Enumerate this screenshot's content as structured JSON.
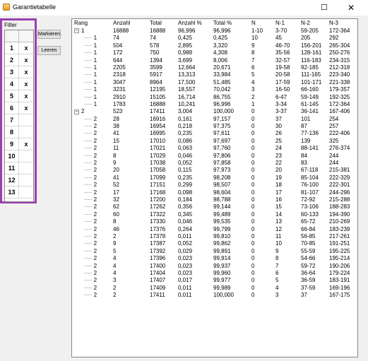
{
  "window": {
    "title": "Garantietabelle",
    "maximize_glyph": "☐",
    "close_glyph": "✕"
  },
  "filter": {
    "label": "Filter",
    "rows": [
      {
        "num": "1",
        "mark": "x"
      },
      {
        "num": "2",
        "mark": "x"
      },
      {
        "num": "3",
        "mark": "x"
      },
      {
        "num": "4",
        "mark": "x"
      },
      {
        "num": "5",
        "mark": "x"
      },
      {
        "num": "6",
        "mark": "x"
      },
      {
        "num": "7",
        "mark": ""
      },
      {
        "num": "8",
        "mark": ""
      },
      {
        "num": "9",
        "mark": "x"
      },
      {
        "num": "10",
        "mark": ""
      },
      {
        "num": "11",
        "mark": ""
      },
      {
        "num": "12",
        "mark": ""
      },
      {
        "num": "13",
        "mark": ""
      }
    ]
  },
  "buttons": {
    "markieren": "Markieren",
    "leeren": "Leeren"
  },
  "table": {
    "columns": [
      "Rang",
      "Anzahl",
      "Total",
      "Anzahl %",
      "Total %",
      "N",
      "N-1",
      "N-2",
      "N-3"
    ],
    "rows": [
      {
        "level": 0,
        "rang": "1",
        "toggle": "−",
        "anzahl": "16888",
        "total": "16888",
        "anzahl_pct": "96,996",
        "total_pct": "96,996",
        "n": "1-10",
        "n1": "3-70",
        "n2": "59-205",
        "n3": "172-364"
      },
      {
        "level": 1,
        "rang": "1",
        "anzahl": "74",
        "total": "74",
        "anzahl_pct": "0,425",
        "total_pct": "0,425",
        "n": "10",
        "n1": "45",
        "n2": "205",
        "n3": "292"
      },
      {
        "level": 1,
        "rang": "1",
        "anzahl": "504",
        "total": "578",
        "anzahl_pct": "2,895",
        "total_pct": "3,320",
        "n": "9",
        "n1": "46-70",
        "n2": "156-201",
        "n3": "265-304"
      },
      {
        "level": 1,
        "rang": "1",
        "anzahl": "172",
        "total": "750",
        "anzahl_pct": "0,988",
        "total_pct": "4,308",
        "n": "8",
        "n1": "35-56",
        "n2": "128-161",
        "n3": "250-276"
      },
      {
        "level": 1,
        "rang": "1",
        "anzahl": "644",
        "total": "1394",
        "anzahl_pct": "3,699",
        "total_pct": "8,006",
        "n": "7",
        "n1": "32-57",
        "n2": "116-183",
        "n3": "234-315"
      },
      {
        "level": 1,
        "rang": "1",
        "anzahl": "2205",
        "total": "3599",
        "anzahl_pct": "12,664",
        "total_pct": "20,671",
        "n": "6",
        "n1": "19-58",
        "n2": "92-185",
        "n3": "212-318"
      },
      {
        "level": 1,
        "rang": "1",
        "anzahl": "2318",
        "total": "5917",
        "anzahl_pct": "13,313",
        "total_pct": "33,984",
        "n": "5",
        "n1": "20-58",
        "n2": "111-165",
        "n3": "223-340"
      },
      {
        "level": 1,
        "rang": "1",
        "anzahl": "3047",
        "total": "8964",
        "anzahl_pct": "17,500",
        "total_pct": "51,485",
        "n": "4",
        "n1": "17-59",
        "n2": "101-171",
        "n3": "221-338"
      },
      {
        "level": 1,
        "rang": "1",
        "anzahl": "3231",
        "total": "12195",
        "anzahl_pct": "18,557",
        "total_pct": "70,042",
        "n": "3",
        "n1": "16-50",
        "n2": "66-160",
        "n3": "179-357"
      },
      {
        "level": 1,
        "rang": "1",
        "anzahl": "2910",
        "total": "15105",
        "anzahl_pct": "16,714",
        "total_pct": "86,755",
        "n": "2",
        "n1": "6-47",
        "n2": "59-149",
        "n3": "192-325"
      },
      {
        "level": 1,
        "rang": "1",
        "anzahl": "1783",
        "total": "16888",
        "anzahl_pct": "10,241",
        "total_pct": "96,996",
        "n": "1",
        "n1": "3-34",
        "n2": "61-145",
        "n3": "172-364"
      },
      {
        "level": 0,
        "rang": "2",
        "toggle": "−",
        "anzahl": "523",
        "total": "17411",
        "anzahl_pct": "3,004",
        "total_pct": "100,000",
        "n": "0",
        "n1": "3-37",
        "n2": "36-141",
        "n3": "167-406"
      },
      {
        "level": 1,
        "rang": "2",
        "anzahl": "28",
        "total": "16916",
        "anzahl_pct": "0,161",
        "total_pct": "97,157",
        "n": "0",
        "n1": "37",
        "n2": "101",
        "n3": "254"
      },
      {
        "level": 1,
        "rang": "2",
        "anzahl": "38",
        "total": "16954",
        "anzahl_pct": "0,218",
        "total_pct": "97,375",
        "n": "0",
        "n1": "30",
        "n2": "87",
        "n3": "257"
      },
      {
        "level": 1,
        "rang": "2",
        "anzahl": "41",
        "total": "16995",
        "anzahl_pct": "0,235",
        "total_pct": "97,611",
        "n": "0",
        "n1": "26",
        "n2": "77-136",
        "n3": "222-406"
      },
      {
        "level": 1,
        "rang": "2",
        "anzahl": "15",
        "total": "17010",
        "anzahl_pct": "0,086",
        "total_pct": "97,697",
        "n": "0",
        "n1": "25",
        "n2": "139",
        "n3": "325"
      },
      {
        "level": 1,
        "rang": "2",
        "anzahl": "11",
        "total": "17021",
        "anzahl_pct": "0,063",
        "total_pct": "97,760",
        "n": "0",
        "n1": "24",
        "n2": "88-141",
        "n3": "276-374"
      },
      {
        "level": 1,
        "rang": "2",
        "anzahl": "8",
        "total": "17029",
        "anzahl_pct": "0,046",
        "total_pct": "97,806",
        "n": "0",
        "n1": "23",
        "n2": "84",
        "n3": "244"
      },
      {
        "level": 1,
        "rang": "2",
        "anzahl": "9",
        "total": "17038",
        "anzahl_pct": "0,052",
        "total_pct": "97,858",
        "n": "0",
        "n1": "22",
        "n2": "83",
        "n3": "244"
      },
      {
        "level": 1,
        "rang": "2",
        "anzahl": "20",
        "total": "17058",
        "anzahl_pct": "0,115",
        "total_pct": "97,973",
        "n": "0",
        "n1": "20",
        "n2": "67-118",
        "n3": "215-381"
      },
      {
        "level": 1,
        "rang": "2",
        "anzahl": "41",
        "total": "17099",
        "anzahl_pct": "0,235",
        "total_pct": "98,208",
        "n": "0",
        "n1": "19",
        "n2": "85-104",
        "n3": "222-329"
      },
      {
        "level": 1,
        "rang": "2",
        "anzahl": "52",
        "total": "17151",
        "anzahl_pct": "0,299",
        "total_pct": "98,507",
        "n": "0",
        "n1": "18",
        "n2": "76-100",
        "n3": "222-301"
      },
      {
        "level": 1,
        "rang": "2",
        "anzahl": "17",
        "total": "17168",
        "anzahl_pct": "0,098",
        "total_pct": "98,604",
        "n": "0",
        "n1": "17",
        "n2": "81-107",
        "n3": "244-296"
      },
      {
        "level": 1,
        "rang": "2",
        "anzahl": "32",
        "total": "17200",
        "anzahl_pct": "0,184",
        "total_pct": "98,788",
        "n": "0",
        "n1": "16",
        "n2": "72-92",
        "n3": "215-288"
      },
      {
        "level": 1,
        "rang": "2",
        "anzahl": "62",
        "total": "17262",
        "anzahl_pct": "0,356",
        "total_pct": "99,144",
        "n": "0",
        "n1": "15",
        "n2": "73-106",
        "n3": "188-283"
      },
      {
        "level": 1,
        "rang": "2",
        "anzahl": "60",
        "total": "17322",
        "anzahl_pct": "0,345",
        "total_pct": "99,489",
        "n": "0",
        "n1": "14",
        "n2": "60-133",
        "n3": "194-390"
      },
      {
        "level": 1,
        "rang": "2",
        "anzahl": "8",
        "total": "17330",
        "anzahl_pct": "0,046",
        "total_pct": "99,535",
        "n": "0",
        "n1": "13",
        "n2": "65-72",
        "n3": "210-269"
      },
      {
        "level": 1,
        "rang": "2",
        "anzahl": "46",
        "total": "17376",
        "anzahl_pct": "0,264",
        "total_pct": "99,799",
        "n": "0",
        "n1": "12",
        "n2": "66-84",
        "n3": "183-239"
      },
      {
        "level": 1,
        "rang": "2",
        "anzahl": "2",
        "total": "17378",
        "anzahl_pct": "0,011",
        "total_pct": "99,810",
        "n": "0",
        "n1": "11",
        "n2": "56-85",
        "n3": "217-261"
      },
      {
        "level": 1,
        "rang": "2",
        "anzahl": "9",
        "total": "17387",
        "anzahl_pct": "0,052",
        "total_pct": "99,862",
        "n": "0",
        "n1": "10",
        "n2": "70-85",
        "n3": "191-251"
      },
      {
        "level": 1,
        "rang": "2",
        "anzahl": "5",
        "total": "17392",
        "anzahl_pct": "0,029",
        "total_pct": "99,891",
        "n": "0",
        "n1": "9",
        "n2": "55-59",
        "n3": "195-225"
      },
      {
        "level": 1,
        "rang": "2",
        "anzahl": "4",
        "total": "17396",
        "anzahl_pct": "0,023",
        "total_pct": "99,914",
        "n": "0",
        "n1": "8",
        "n2": "54-66",
        "n3": "195-214"
      },
      {
        "level": 1,
        "rang": "2",
        "anzahl": "4",
        "total": "17400",
        "anzahl_pct": "0,023",
        "total_pct": "99,937",
        "n": "0",
        "n1": "7",
        "n2": "59-72",
        "n3": "190-206"
      },
      {
        "level": 1,
        "rang": "2",
        "anzahl": "4",
        "total": "17404",
        "anzahl_pct": "0,023",
        "total_pct": "99,960",
        "n": "0",
        "n1": "6",
        "n2": "36-64",
        "n3": "179-224"
      },
      {
        "level": 1,
        "rang": "2",
        "anzahl": "3",
        "total": "17407",
        "anzahl_pct": "0,017",
        "total_pct": "99,977",
        "n": "0",
        "n1": "5",
        "n2": "36-59",
        "n3": "183-191"
      },
      {
        "level": 1,
        "rang": "2",
        "anzahl": "2",
        "total": "17409",
        "anzahl_pct": "0,011",
        "total_pct": "99,989",
        "n": "0",
        "n1": "4",
        "n2": "37-59",
        "n3": "169-196"
      },
      {
        "level": 1,
        "rang": "2",
        "anzahl": "2",
        "total": "17411",
        "anzahl_pct": "0,011",
        "total_pct": "100,000",
        "n": "0",
        "n1": "3",
        "n2": "37",
        "n3": "167-175"
      }
    ]
  }
}
